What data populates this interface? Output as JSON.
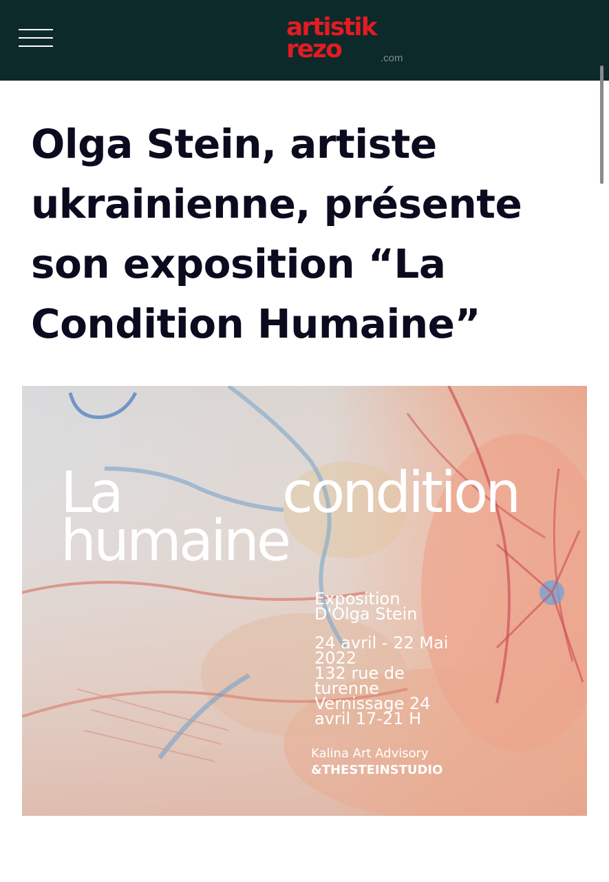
{
  "header": {
    "menu_icon": "hamburger-menu-icon",
    "logo_line1": "artistik",
    "logo_line2": "rezo",
    "logo_suffix": ".com",
    "background": "#0d2a2a",
    "logo_color": "#e31b23"
  },
  "article": {
    "title": "Olga Stein, artiste ukrainienne, présente son exposition “La Condition Humaine”"
  },
  "poster": {
    "word1": "La",
    "word2": "condition",
    "word3": "humaine",
    "exposition_lines": [
      "Exposition",
      "D'Olga Stein"
    ],
    "date_lines": [
      "24 avril - 22 Mai",
      "2022",
      "132 rue de",
      "turenne",
      "Vernissage 24",
      "avril 17-21 H"
    ],
    "credit_line1": "Kalina Art Advisory",
    "credit_line2": "&THESTEINSTUDIO"
  }
}
